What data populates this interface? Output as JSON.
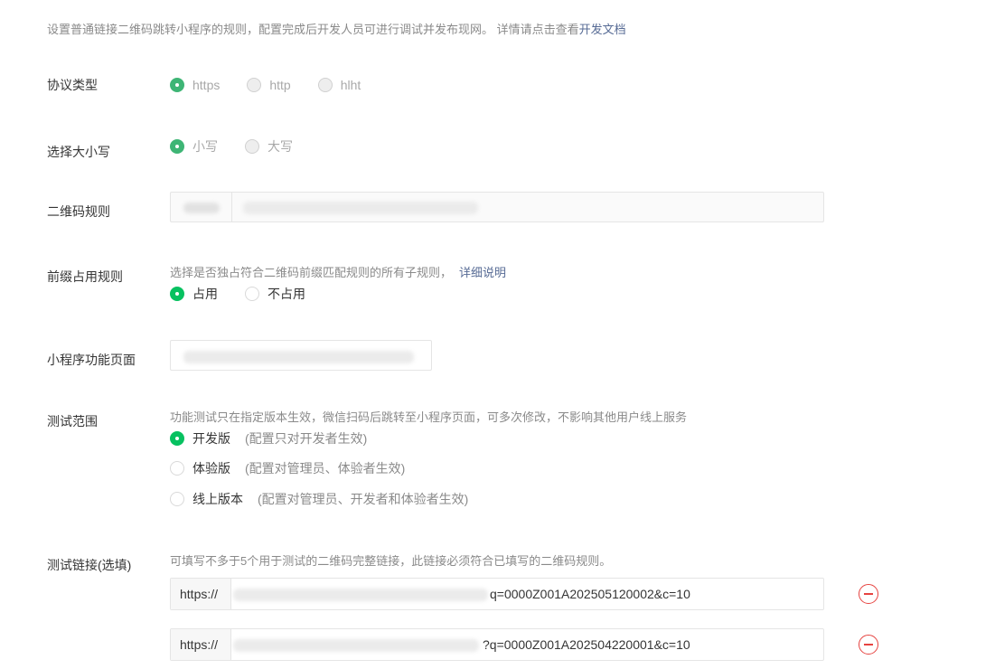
{
  "intro": {
    "text": "设置普通链接二维码跳转小程序的规则，配置完成后开发人员可进行调试并发布现网。 详情请点击查看",
    "link": "开发文档"
  },
  "protocol": {
    "label": "协议类型",
    "options": [
      "https",
      "http",
      "hlht"
    ],
    "selected": "https"
  },
  "case": {
    "label": "选择大小写",
    "options": [
      "小写",
      "大写"
    ],
    "selected": "小写"
  },
  "qr_rule": {
    "label": "二维码规则"
  },
  "prefix": {
    "label": "前缀占用规则",
    "hint": "选择是否独占符合二维码前缀匹配规则的所有子规则，",
    "hint_link": "详细说明",
    "options": [
      "占用",
      "不占用"
    ],
    "selected": "占用"
  },
  "page": {
    "label": "小程序功能页面"
  },
  "scope": {
    "label": "测试范围",
    "hint": "功能测试只在指定版本生效，微信扫码后跳转至小程序页面，可多次修改，不影响其他用户线上服务",
    "options": [
      {
        "name": "开发版",
        "note": "(配置只对开发者生效)"
      },
      {
        "name": "体验版",
        "note": "(配置对管理员、体验者生效)"
      },
      {
        "name": "线上版本",
        "note": "(配置对管理员、开发者和体验者生效)"
      }
    ],
    "selected": "开发版"
  },
  "test_links": {
    "label": "测试链接(选填)",
    "hint": "可填写不多于5个用于测试的二维码完整链接，此链接必须符合已填写的二维码规则。",
    "items": [
      {
        "protocol": "https://",
        "tail": "q=0000Z001A202505120002&c=10"
      },
      {
        "protocol": "https://",
        "tail": "?q=0000Z001A202504220001&c=10"
      }
    ]
  },
  "colors": {
    "accent": "#07c160",
    "link": "#576b95",
    "danger": "#e64340"
  }
}
